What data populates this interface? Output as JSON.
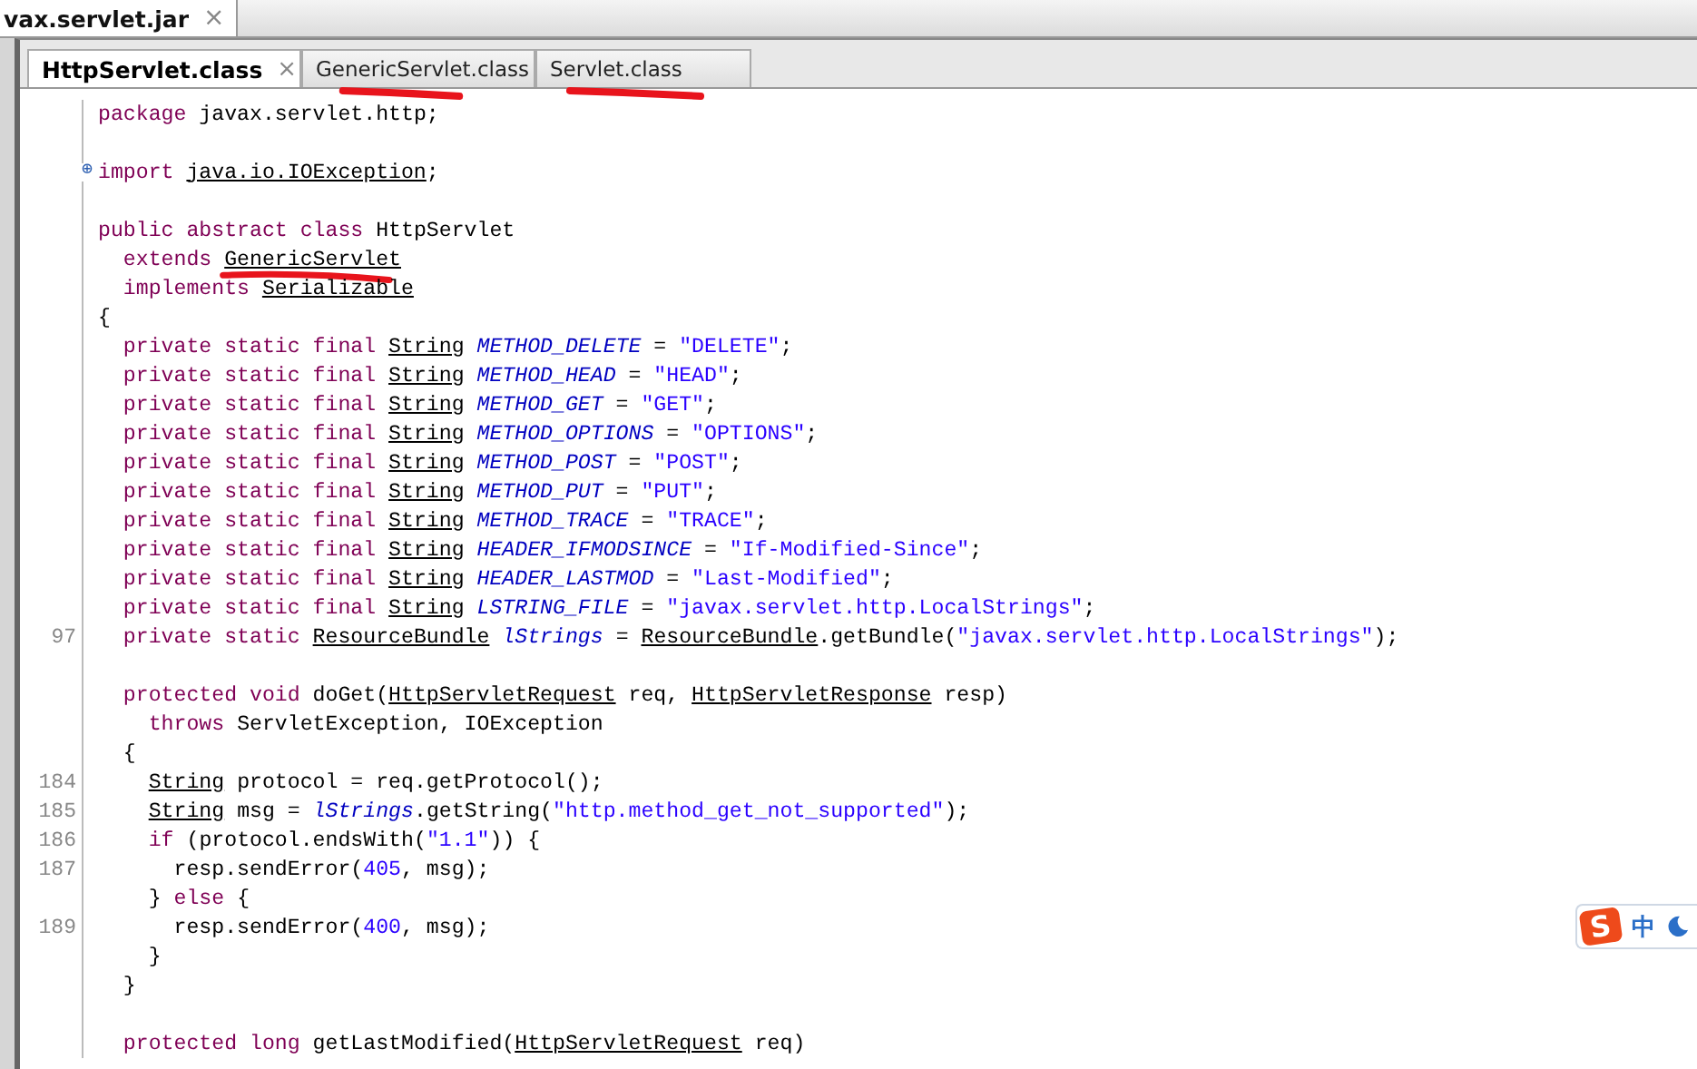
{
  "file_tab": {
    "label": "vax.servlet.jar",
    "close": "×"
  },
  "class_tabs": [
    {
      "label": "HttpServlet.class",
      "selected": true,
      "close": "×",
      "hand_mark": false
    },
    {
      "label": "GenericServlet.class",
      "selected": false,
      "hand_mark": true
    },
    {
      "label": "Servlet.class",
      "selected": false,
      "hand_mark": true
    }
  ],
  "code_lines": [
    {
      "kind": "code",
      "tokens": [
        {
          "kind": "kw",
          "text": "package"
        },
        {
          "kind": "plain",
          "text": " javax.servlet.http;"
        }
      ]
    },
    {
      "kind": "blank"
    },
    {
      "kind": "code",
      "expander": "⊕",
      "tokens": [
        {
          "kind": "kw",
          "text": "import "
        },
        {
          "kind": "ref",
          "text": "java.io.IOException"
        },
        {
          "kind": "plain",
          "text": ";"
        }
      ]
    },
    {
      "kind": "blank"
    },
    {
      "kind": "code",
      "tokens": [
        {
          "kind": "kw",
          "text": "public abstract class"
        },
        {
          "kind": "plain",
          "text": " HttpServlet"
        }
      ]
    },
    {
      "kind": "code",
      "tokens": [
        {
          "kind": "kw",
          "text": "  extends "
        },
        {
          "kind": "ref",
          "text": "GenericServlet",
          "hand_mark": true
        }
      ]
    },
    {
      "kind": "code",
      "tokens": [
        {
          "kind": "kw",
          "text": "  implements "
        },
        {
          "kind": "ref",
          "text": "Serializable"
        }
      ]
    },
    {
      "kind": "code",
      "tokens": [
        {
          "kind": "plain",
          "text": "{"
        }
      ]
    },
    {
      "kind": "code",
      "tokens": [
        {
          "kind": "kw",
          "text": "  private static final "
        },
        {
          "kind": "ref",
          "text": "String"
        },
        {
          "kind": "field",
          "text": " METHOD_DELETE"
        },
        {
          "kind": "plain",
          "text": " = "
        },
        {
          "kind": "str",
          "text": "\"DELETE\""
        },
        {
          "kind": "plain",
          "text": ";"
        }
      ]
    },
    {
      "kind": "code",
      "tokens": [
        {
          "kind": "kw",
          "text": "  private static final "
        },
        {
          "kind": "ref",
          "text": "String"
        },
        {
          "kind": "field",
          "text": " METHOD_HEAD"
        },
        {
          "kind": "plain",
          "text": " = "
        },
        {
          "kind": "str",
          "text": "\"HEAD\""
        },
        {
          "kind": "plain",
          "text": ";"
        }
      ]
    },
    {
      "kind": "code",
      "tokens": [
        {
          "kind": "kw",
          "text": "  private static final "
        },
        {
          "kind": "ref",
          "text": "String"
        },
        {
          "kind": "field",
          "text": " METHOD_GET"
        },
        {
          "kind": "plain",
          "text": " = "
        },
        {
          "kind": "str",
          "text": "\"GET\""
        },
        {
          "kind": "plain",
          "text": ";"
        }
      ]
    },
    {
      "kind": "code",
      "tokens": [
        {
          "kind": "kw",
          "text": "  private static final "
        },
        {
          "kind": "ref",
          "text": "String"
        },
        {
          "kind": "field",
          "text": " METHOD_OPTIONS"
        },
        {
          "kind": "plain",
          "text": " = "
        },
        {
          "kind": "str",
          "text": "\"OPTIONS\""
        },
        {
          "kind": "plain",
          "text": ";"
        }
      ]
    },
    {
      "kind": "code",
      "tokens": [
        {
          "kind": "kw",
          "text": "  private static final "
        },
        {
          "kind": "ref",
          "text": "String"
        },
        {
          "kind": "field",
          "text": " METHOD_POST"
        },
        {
          "kind": "plain",
          "text": " = "
        },
        {
          "kind": "str",
          "text": "\"POST\""
        },
        {
          "kind": "plain",
          "text": ";"
        }
      ]
    },
    {
      "kind": "code",
      "tokens": [
        {
          "kind": "kw",
          "text": "  private static final "
        },
        {
          "kind": "ref",
          "text": "String"
        },
        {
          "kind": "field",
          "text": " METHOD_PUT"
        },
        {
          "kind": "plain",
          "text": " = "
        },
        {
          "kind": "str",
          "text": "\"PUT\""
        },
        {
          "kind": "plain",
          "text": ";"
        }
      ]
    },
    {
      "kind": "code",
      "tokens": [
        {
          "kind": "kw",
          "text": "  private static final "
        },
        {
          "kind": "ref",
          "text": "String"
        },
        {
          "kind": "field",
          "text": " METHOD_TRACE"
        },
        {
          "kind": "plain",
          "text": " = "
        },
        {
          "kind": "str",
          "text": "\"TRACE\""
        },
        {
          "kind": "plain",
          "text": ";"
        }
      ]
    },
    {
      "kind": "code",
      "tokens": [
        {
          "kind": "kw",
          "text": "  private static final "
        },
        {
          "kind": "ref",
          "text": "String"
        },
        {
          "kind": "field",
          "text": " HEADER_IFMODSINCE"
        },
        {
          "kind": "plain",
          "text": " = "
        },
        {
          "kind": "str",
          "text": "\"If-Modified-Since\""
        },
        {
          "kind": "plain",
          "text": ";"
        }
      ]
    },
    {
      "kind": "code",
      "tokens": [
        {
          "kind": "kw",
          "text": "  private static final "
        },
        {
          "kind": "ref",
          "text": "String"
        },
        {
          "kind": "field",
          "text": " HEADER_LASTMOD"
        },
        {
          "kind": "plain",
          "text": " = "
        },
        {
          "kind": "str",
          "text": "\"Last-Modified\""
        },
        {
          "kind": "plain",
          "text": ";"
        }
      ]
    },
    {
      "kind": "code",
      "tokens": [
        {
          "kind": "kw",
          "text": "  private static final "
        },
        {
          "kind": "ref",
          "text": "String"
        },
        {
          "kind": "field",
          "text": " LSTRING_FILE"
        },
        {
          "kind": "plain",
          "text": " = "
        },
        {
          "kind": "str",
          "text": "\"javax.servlet.http.LocalStrings\""
        },
        {
          "kind": "plain",
          "text": ";"
        }
      ]
    },
    {
      "kind": "code",
      "number": "97",
      "tokens": [
        {
          "kind": "kw",
          "text": "  private static "
        },
        {
          "kind": "ref",
          "text": "ResourceBundle"
        },
        {
          "kind": "field",
          "text": " lStrings"
        },
        {
          "kind": "plain",
          "text": " = "
        },
        {
          "kind": "ref",
          "text": "ResourceBundle"
        },
        {
          "kind": "plain",
          "text": ".getBundle("
        },
        {
          "kind": "str",
          "text": "\"javax.servlet.http.LocalStrings\""
        },
        {
          "kind": "plain",
          "text": ");"
        }
      ]
    },
    {
      "kind": "blank"
    },
    {
      "kind": "code",
      "tokens": [
        {
          "kind": "kw",
          "text": "  protected void"
        },
        {
          "kind": "plain",
          "text": " doGet("
        },
        {
          "kind": "ref",
          "text": "HttpServletRequest"
        },
        {
          "kind": "plain",
          "text": " req, "
        },
        {
          "kind": "ref",
          "text": "HttpServletResponse"
        },
        {
          "kind": "plain",
          "text": " resp)"
        }
      ]
    },
    {
      "kind": "code",
      "tokens": [
        {
          "kind": "kw",
          "text": "    throws"
        },
        {
          "kind": "plain",
          "text": " ServletException, IOException"
        }
      ]
    },
    {
      "kind": "code",
      "tokens": [
        {
          "kind": "plain",
          "text": "  {"
        }
      ]
    },
    {
      "kind": "code",
      "number": "184",
      "tokens": [
        {
          "kind": "ref",
          "text": "    String"
        },
        {
          "kind": "plain",
          "text": " protocol = req.getProtocol();"
        }
      ]
    },
    {
      "kind": "code",
      "number": "185",
      "tokens": [
        {
          "kind": "ref",
          "text": "    String"
        },
        {
          "kind": "plain",
          "text": " msg = "
        },
        {
          "kind": "field",
          "text": "lStrings"
        },
        {
          "kind": "plain",
          "text": ".getString("
        },
        {
          "kind": "str",
          "text": "\"http.method_get_not_supported\""
        },
        {
          "kind": "plain",
          "text": ");"
        }
      ]
    },
    {
      "kind": "code",
      "number": "186",
      "tokens": [
        {
          "kind": "kw",
          "text": "    if"
        },
        {
          "kind": "plain",
          "text": " (protocol.endsWith("
        },
        {
          "kind": "str",
          "text": "\"1.1\""
        },
        {
          "kind": "plain",
          "text": ")) {"
        }
      ]
    },
    {
      "kind": "code",
      "number": "187",
      "tokens": [
        {
          "kind": "plain",
          "text": "      resp.sendError("
        },
        {
          "kind": "str",
          "text": "405"
        },
        {
          "kind": "plain",
          "text": ", msg);"
        }
      ]
    },
    {
      "kind": "code",
      "tokens": [
        {
          "kind": "plain",
          "text": "    } "
        },
        {
          "kind": "kw",
          "text": "else"
        },
        {
          "kind": "plain",
          "text": " {"
        }
      ]
    },
    {
      "kind": "code",
      "number": "189",
      "tokens": [
        {
          "kind": "plain",
          "text": "      resp.sendError("
        },
        {
          "kind": "str",
          "text": "400"
        },
        {
          "kind": "plain",
          "text": ", msg);"
        }
      ]
    },
    {
      "kind": "code",
      "tokens": [
        {
          "kind": "plain",
          "text": "    }"
        }
      ]
    },
    {
      "kind": "code",
      "tokens": [
        {
          "kind": "plain",
          "text": "  }"
        }
      ]
    },
    {
      "kind": "blank"
    },
    {
      "kind": "code",
      "tokens": [
        {
          "kind": "kw",
          "text": "  protected long"
        },
        {
          "kind": "plain",
          "text": " getLastModified("
        },
        {
          "kind": "ref",
          "text": "HttpServletRequest"
        },
        {
          "kind": "plain",
          "text": " req)"
        }
      ]
    }
  ],
  "ime": {
    "logo": "S",
    "label": "中"
  }
}
